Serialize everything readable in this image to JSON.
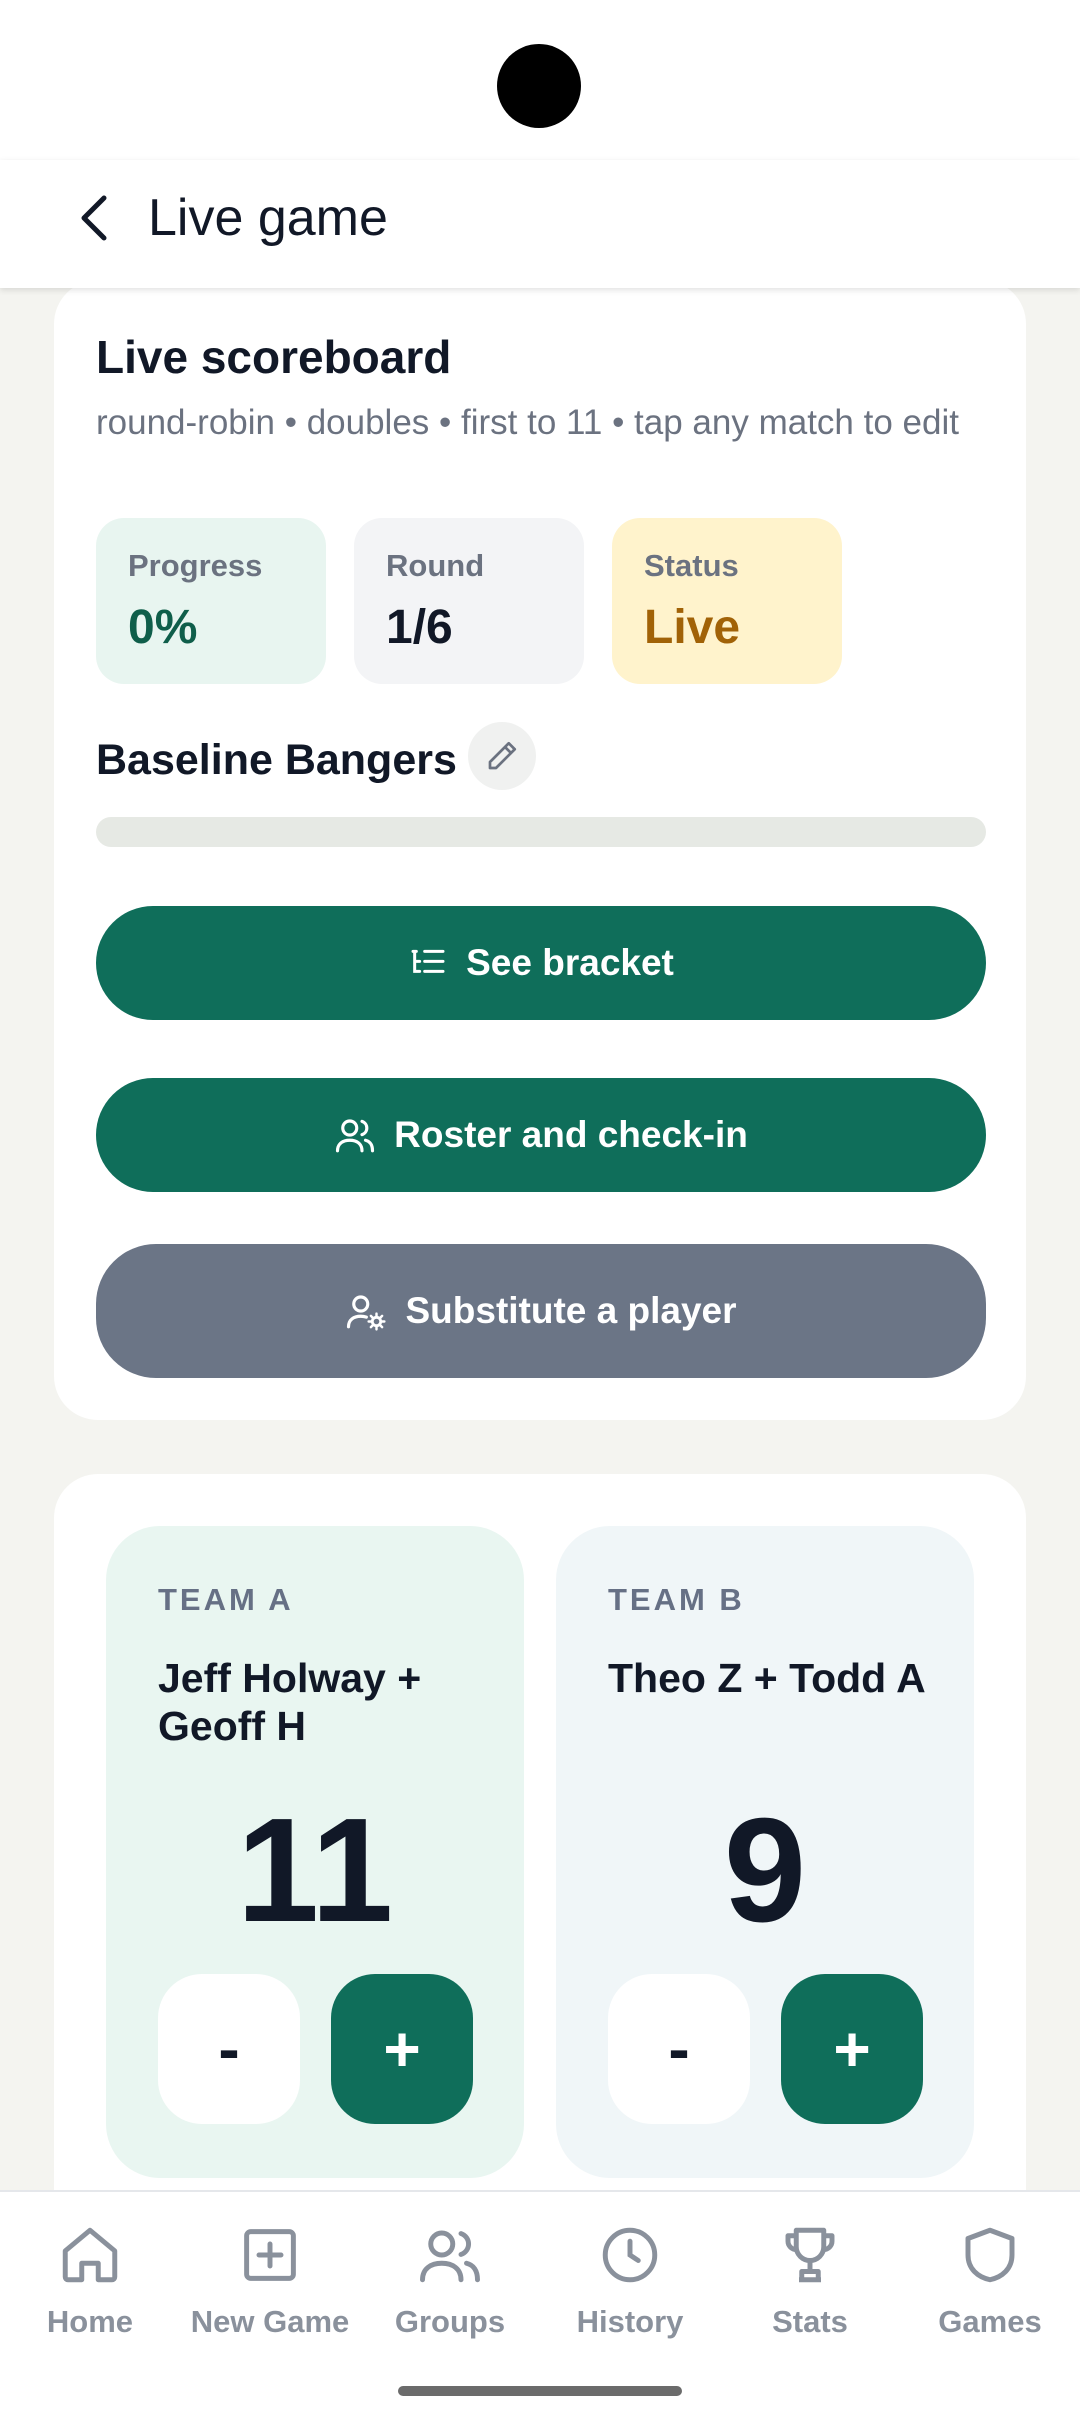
{
  "header": {
    "title": "Live game"
  },
  "scoreboard": {
    "title": "Live scoreboard",
    "subtitle": "round-robin • doubles • first to 11 • tap any match to edit",
    "stats": [
      {
        "label": "Progress",
        "value": "0%",
        "bg": "#e8f5f0",
        "color": "#0f5e4a"
      },
      {
        "label": "Round",
        "value": "1/6",
        "bg": "#f3f4f6",
        "color": "#111827"
      },
      {
        "label": "Status",
        "value": "Live",
        "bg": "#fff3cc",
        "color": "#a16207"
      }
    ],
    "group_name": "Baseline Bangers",
    "progress_fraction": 0.0,
    "buttons": {
      "bracket": "See bracket",
      "roster": "Roster and check-in",
      "substitute": "Substitute a player"
    }
  },
  "match": {
    "team_a": {
      "label": "TEAM A",
      "players": "Jeff Holway + Geoff H",
      "score": "11",
      "bg": "#e9f6f1"
    },
    "team_b": {
      "label": "TEAM B",
      "players": "Theo Z + Todd A",
      "score": "9",
      "bg": "#f0f6f8"
    },
    "minus_label": "-",
    "plus_label": "+"
  },
  "nav": {
    "items": [
      {
        "label": "Home",
        "icon": "home-icon"
      },
      {
        "label": "New Game",
        "icon": "plus-square-icon"
      },
      {
        "label": "Groups",
        "icon": "users-icon"
      },
      {
        "label": "History",
        "icon": "clock-icon"
      },
      {
        "label": "Stats",
        "icon": "trophy-icon"
      },
      {
        "label": "Games",
        "icon": "shield-icon"
      }
    ]
  },
  "colors": {
    "primary": "#0f6e5a",
    "secondary_button": "#6b7586",
    "nav_inactive": "#8a919c"
  }
}
